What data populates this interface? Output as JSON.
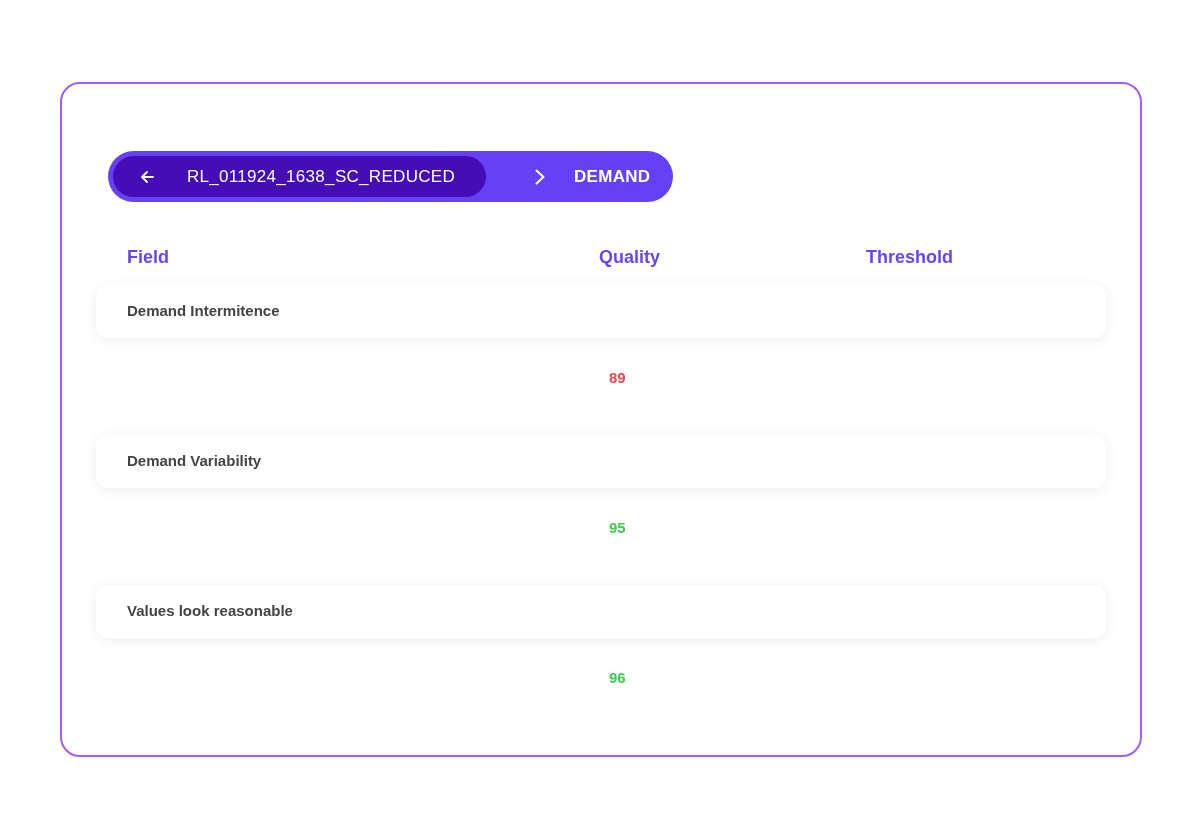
{
  "breadcrumb": {
    "dataset": "RL_011924_1638_SC_REDUCED",
    "section": "DEMAND"
  },
  "columns": [
    "Field",
    "Quality",
    "Threshold"
  ],
  "rows": [
    {
      "field": "Demand Intermitence",
      "quality": "89",
      "color": "#e34b4b"
    },
    {
      "field": "Demand Variability",
      "quality": "95",
      "color": "#3ecb4c"
    },
    {
      "field": "Values look reasonable",
      "quality": "96",
      "color": "#3ecb4c"
    }
  ]
}
